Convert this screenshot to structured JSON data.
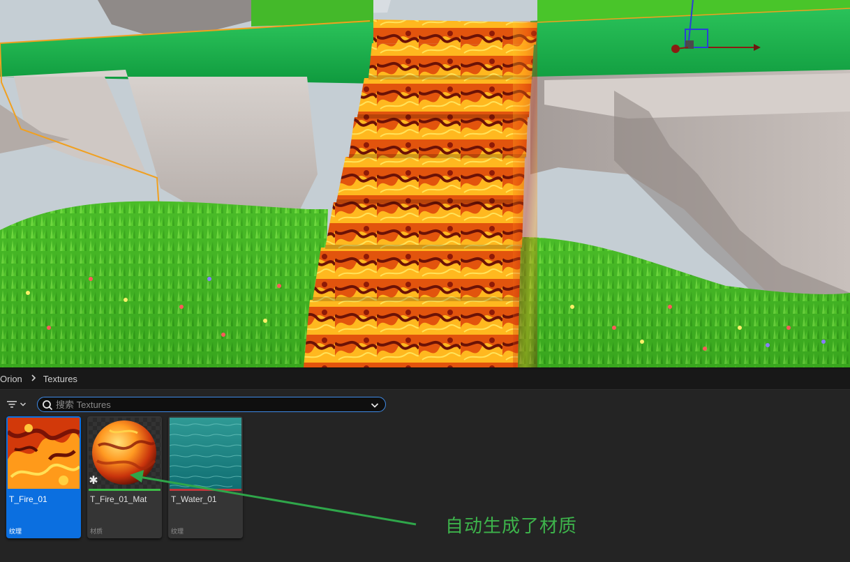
{
  "breadcrumb": {
    "items": [
      "Orion",
      "Textures"
    ],
    "separator_icon": "chevron-right-icon"
  },
  "toolbar": {
    "filter_icon": "filter-icon",
    "dropdown_icon": "chevron-down-icon"
  },
  "search": {
    "placeholder": "搜索 Textures",
    "value": "",
    "icon": "search-icon"
  },
  "assets": [
    {
      "name": "T_Fire_01",
      "type": "纹理",
      "selected": true,
      "underline_color": "#0b6fe0"
    },
    {
      "name": "T_Fire_01_Mat",
      "type": "材质",
      "selected": false,
      "underline_color": "#3dbb47",
      "badge_icon": "asterisk-icon"
    },
    {
      "name": "T_Water_01",
      "type": "纹理",
      "selected": false,
      "underline_color": "#c0363c"
    }
  ],
  "annotation": {
    "text": "自动生成了材质",
    "color": "#3db34b"
  },
  "colors": {
    "accent": "#0b6fe0",
    "search_border": "#3e8be8",
    "selection_outline": "#f0a020"
  }
}
